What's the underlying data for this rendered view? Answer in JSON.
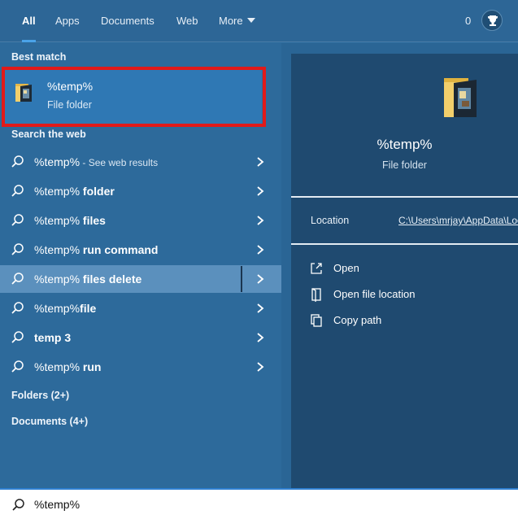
{
  "tabs": [
    {
      "label": "All",
      "active": true
    },
    {
      "label": "Apps"
    },
    {
      "label": "Documents"
    },
    {
      "label": "Web"
    },
    {
      "label": "More"
    }
  ],
  "header": {
    "points": "0",
    "rewards_icon": "trophy-icon"
  },
  "sections": {
    "best_match": "Best match",
    "search_web": "Search the web",
    "folders": "Folders (2+)",
    "documents": "Documents (4+)"
  },
  "best_match": {
    "title": "%temp%",
    "subtitle": "File folder",
    "icon": "folder-icon"
  },
  "web_results": [
    {
      "query": "%temp%",
      "bold": "",
      "suffix": " - See web results"
    },
    {
      "query": "%temp%",
      "bold": " folder",
      "suffix": ""
    },
    {
      "query": "%temp%",
      "bold": " files",
      "suffix": ""
    },
    {
      "query": "%temp%",
      "bold": " run command",
      "suffix": ""
    },
    {
      "query": "%temp%",
      "bold": " files delete",
      "suffix": "",
      "highlighted": true
    },
    {
      "query": "%temp%",
      "bold": "file",
      "suffix": ""
    },
    {
      "query": "",
      "bold": "temp 3",
      "suffix": ""
    },
    {
      "query": "%temp%",
      "bold": " run",
      "suffix": ""
    }
  ],
  "preview": {
    "title": "%temp%",
    "subtitle": "File folder",
    "location_label": "Location",
    "location_value": "C:\\Users\\mrjay\\AppData\\Local\\Temp",
    "actions": [
      {
        "label": "Open",
        "icon": "open-icon"
      },
      {
        "label": "Open file location",
        "icon": "file-location-icon"
      },
      {
        "label": "Copy path",
        "icon": "copy-icon"
      }
    ]
  },
  "search": {
    "query": "%temp%"
  },
  "colors": {
    "highlight_border": "#e11a1a",
    "accent": "#4aa3e8",
    "pane": "#2d6a9b",
    "card": "#1f4a70"
  }
}
